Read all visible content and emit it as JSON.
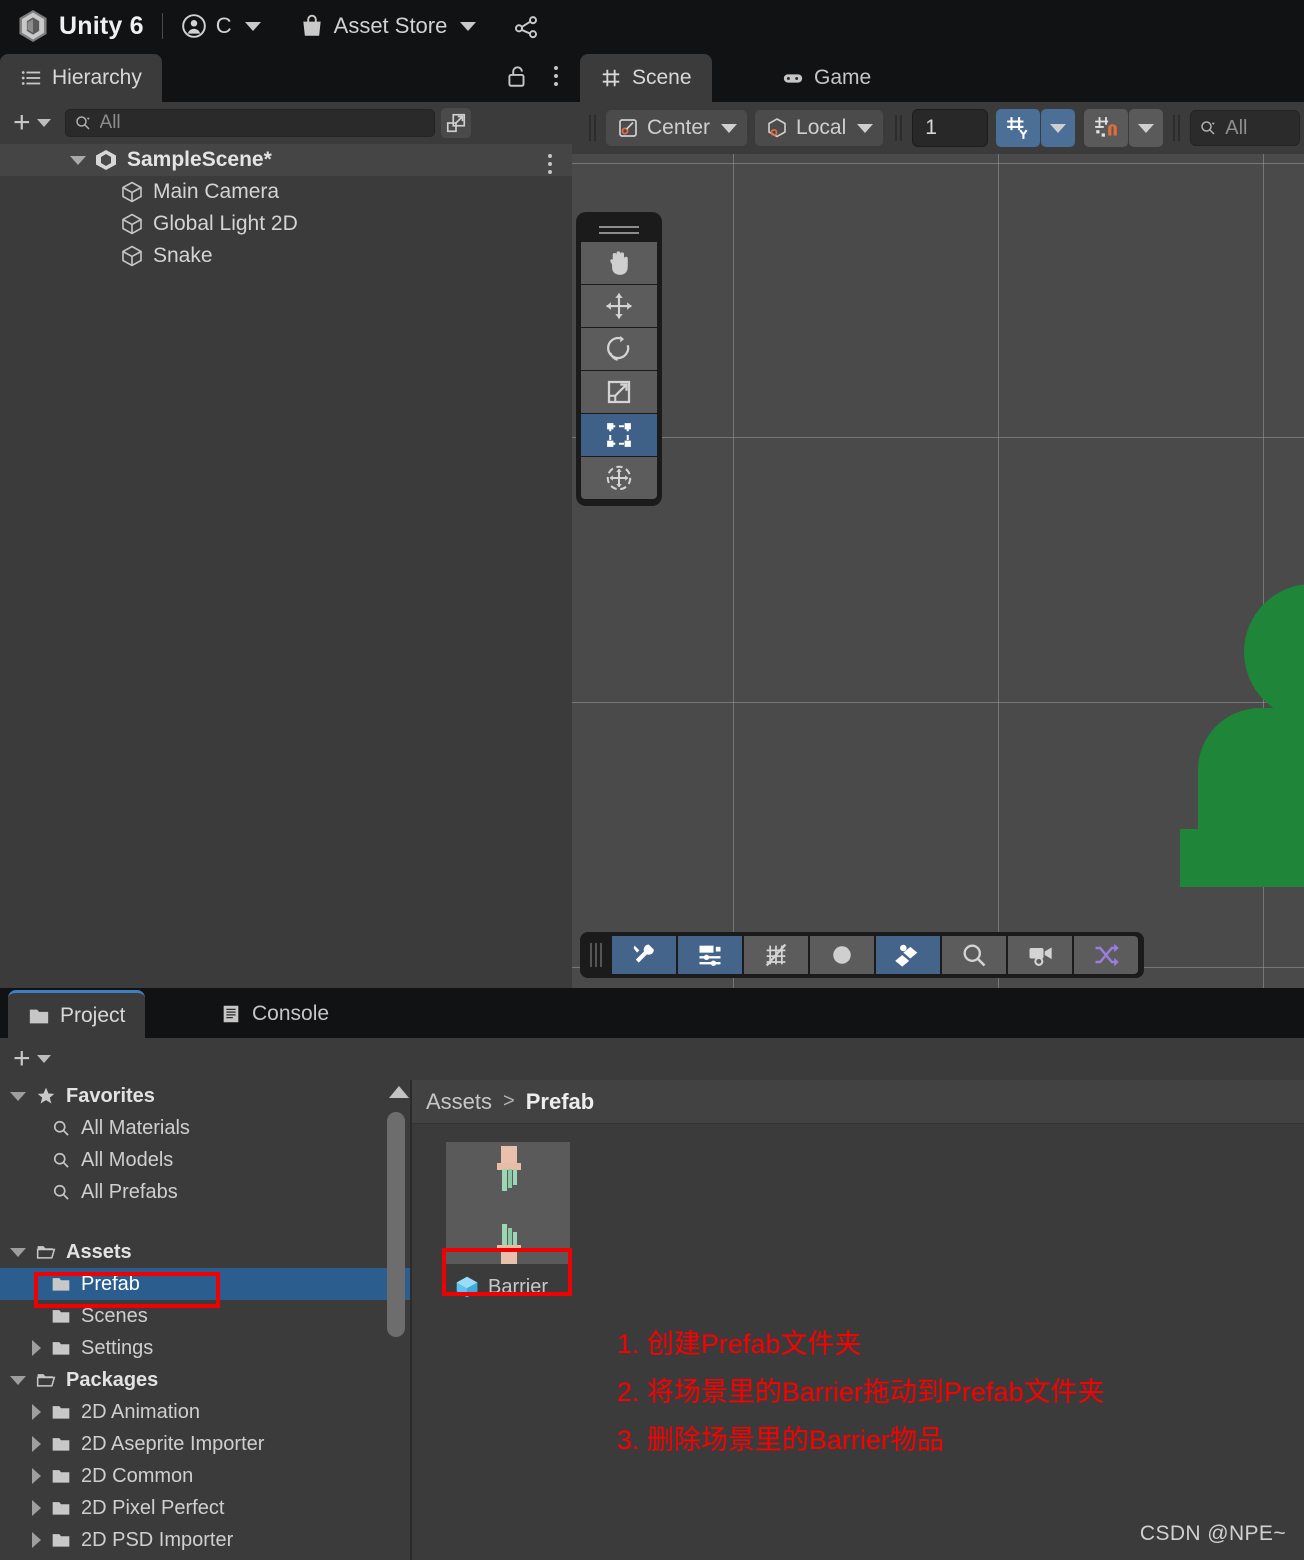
{
  "app": {
    "brand": "Unity 6",
    "account_label": "C",
    "asset_store_label": "Asset Store"
  },
  "hierarchy": {
    "tab_label": "Hierarchy",
    "search_placeholder": "All",
    "search_value": "",
    "rows": [
      {
        "label": "SampleScene*",
        "type": "scene",
        "expanded": true
      },
      {
        "label": "Main Camera",
        "type": "gameobject"
      },
      {
        "label": "Global Light 2D",
        "type": "gameobject"
      },
      {
        "label": "Snake",
        "type": "gameobject"
      }
    ]
  },
  "scene": {
    "tabs": [
      {
        "label": "Scene",
        "icon": "grid-icon",
        "active": true
      },
      {
        "label": "Game",
        "icon": "gamepad-icon",
        "active": false
      }
    ],
    "toolbar": {
      "pivot_label": "Center",
      "handle_label": "Local",
      "grid_size_value": "1",
      "search_placeholder": "All"
    },
    "tools": [
      {
        "name": "hand-tool",
        "selected": false
      },
      {
        "name": "move-tool",
        "selected": false
      },
      {
        "name": "rotate-tool",
        "selected": false
      },
      {
        "name": "scale-tool",
        "selected": false
      },
      {
        "name": "rect-tool",
        "selected": true
      },
      {
        "name": "transform-tool",
        "selected": false
      }
    ],
    "bottom_toolbar": [
      {
        "name": "gizmos-tools-toggle",
        "active": true
      },
      {
        "name": "render-settings-toggle",
        "active": true
      },
      {
        "name": "grid-visibility-toggle",
        "active": false
      },
      {
        "name": "scene-lighting-toggle",
        "active": false
      },
      {
        "name": "layers-toggle",
        "active": true
      },
      {
        "name": "scene-search-button",
        "active": false
      },
      {
        "name": "scene-camera-button",
        "active": false
      },
      {
        "name": "gizmos-shuffle-button",
        "active": false
      }
    ]
  },
  "project": {
    "tabs": [
      {
        "label": "Project",
        "icon": "folder-icon",
        "active": true
      },
      {
        "label": "Console",
        "icon": "console-icon",
        "active": false
      }
    ],
    "tree": [
      {
        "label": "Favorites",
        "depth": 0,
        "fold": "open",
        "icon": "star-icon",
        "bold": true
      },
      {
        "label": "All Materials",
        "depth": 1,
        "fold": "none",
        "icon": "search-icon"
      },
      {
        "label": "All Models",
        "depth": 1,
        "fold": "none",
        "icon": "search-icon"
      },
      {
        "label": "All Prefabs",
        "depth": 1,
        "fold": "none",
        "icon": "search-icon"
      },
      {
        "label": "Assets",
        "depth": 0,
        "fold": "open",
        "icon": "folder-open-icon",
        "bold": true
      },
      {
        "label": "Prefab",
        "depth": 1,
        "fold": "none",
        "icon": "folder-icon",
        "selected": true,
        "highlight": true
      },
      {
        "label": "Scenes",
        "depth": 1,
        "fold": "none",
        "icon": "folder-icon"
      },
      {
        "label": "Settings",
        "depth": 1,
        "fold": "closed",
        "icon": "folder-icon"
      },
      {
        "label": "Packages",
        "depth": 0,
        "fold": "open",
        "icon": "folder-open-icon",
        "bold": true
      },
      {
        "label": "2D Animation",
        "depth": 1,
        "fold": "closed",
        "icon": "folder-icon"
      },
      {
        "label": "2D Aseprite Importer",
        "depth": 1,
        "fold": "closed",
        "icon": "folder-icon"
      },
      {
        "label": "2D Common",
        "depth": 1,
        "fold": "closed",
        "icon": "folder-icon"
      },
      {
        "label": "2D Pixel Perfect",
        "depth": 1,
        "fold": "closed",
        "icon": "folder-icon"
      },
      {
        "label": "2D PSD Importer",
        "depth": 1,
        "fold": "closed",
        "icon": "folder-icon"
      }
    ],
    "breadcrumb": {
      "root": "Assets",
      "separator": ">",
      "current": "Prefab"
    },
    "assets": [
      {
        "label": "Barrier",
        "icon": "prefab-cube-icon",
        "highlight": true
      }
    ]
  },
  "annotations": {
    "lines": [
      "1. 创建Prefab文件夹",
      "2. 将场景里的Barrier拖动到Prefab文件夹",
      "3. 删除场景里的Barrier物品"
    ],
    "color": "#fb0000"
  },
  "watermark": "CSDN @NPE~",
  "colors": {
    "accent_blue": "#2c5d8f",
    "toolbar_active": "#4b6f96",
    "panel_bg": "#3b3b3b",
    "topbar_bg": "#111213",
    "scene_bg": "#4a4a4a",
    "snake_green": "#1e8539",
    "annotation_red": "#fb0000"
  }
}
